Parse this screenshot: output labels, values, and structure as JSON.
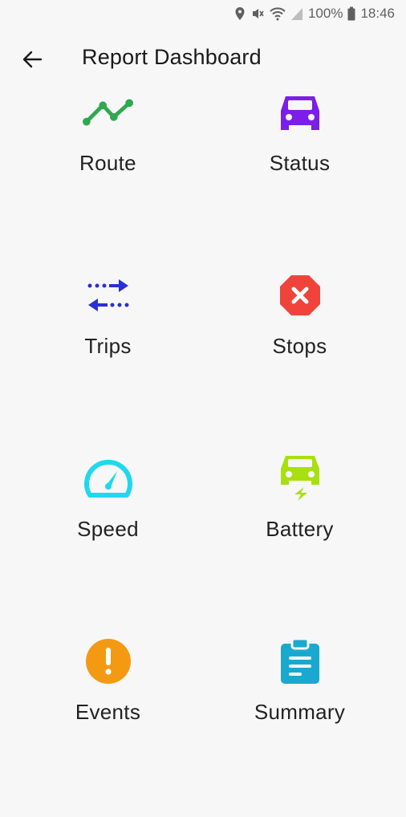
{
  "status_bar": {
    "battery_percent": "100%",
    "time": "18:46",
    "icons": [
      "location-icon",
      "mute-icon",
      "wifi-icon",
      "signal-icon",
      "battery-icon"
    ]
  },
  "app_bar": {
    "title": "Report Dashboard",
    "back_icon": "arrow-left-icon"
  },
  "tiles": [
    {
      "label": "Route",
      "icon": "route-line-icon",
      "color": "#2fa84f"
    },
    {
      "label": "Status",
      "icon": "car-icon",
      "color": "#7b1fe8"
    },
    {
      "label": "Trips",
      "icon": "swap-arrows-icon",
      "color": "#2b2fd6"
    },
    {
      "label": "Stops",
      "icon": "stop-octagon-icon",
      "color": "#f0433a"
    },
    {
      "label": "Speed",
      "icon": "speedometer-icon",
      "color": "#1fd8ee"
    },
    {
      "label": "Battery",
      "icon": "car-charging-icon",
      "color": "#a8e00f"
    },
    {
      "label": "Events",
      "icon": "alert-circle-icon",
      "color": "#f39a12"
    },
    {
      "label": "Summary",
      "icon": "clipboard-icon",
      "color": "#19a9cf"
    }
  ]
}
